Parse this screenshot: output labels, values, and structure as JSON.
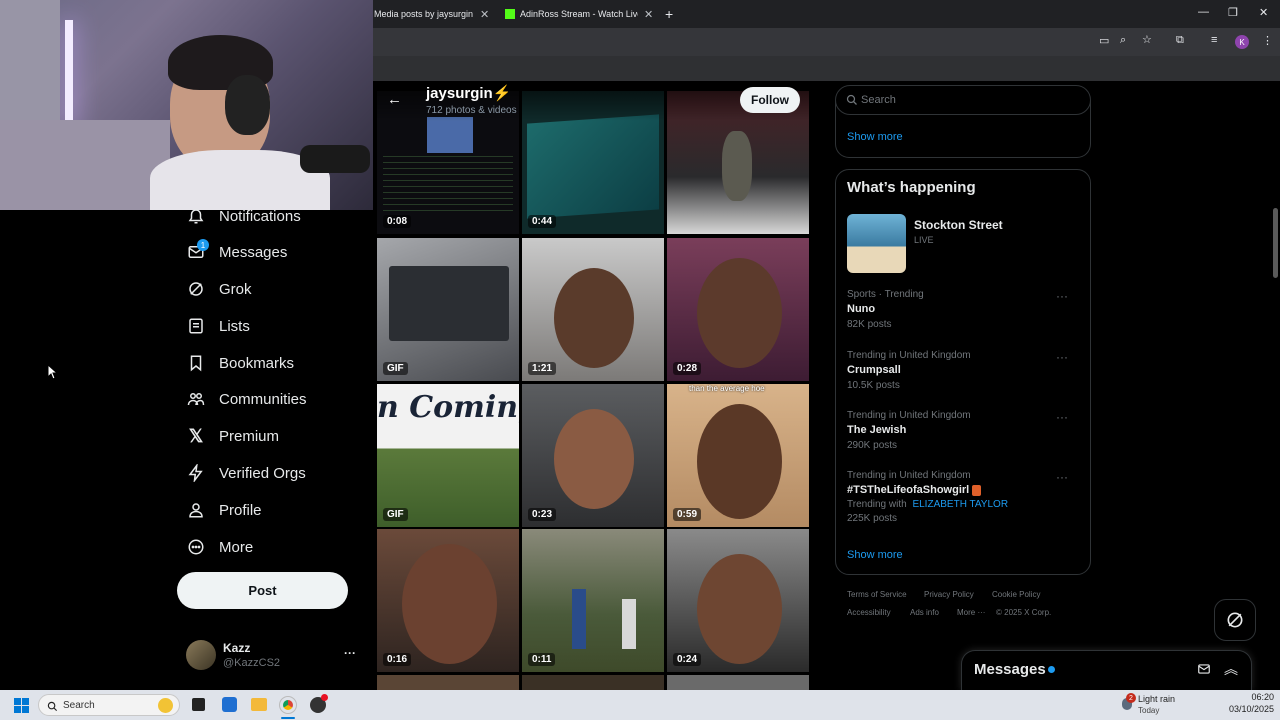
{
  "browser": {
    "tabs": [
      {
        "title": "Media posts by jaysurgin⚡",
        "close": "✕"
      },
      {
        "title": "AdinRoss Stream - Watch Live o",
        "close": "✕"
      }
    ],
    "new_tab": "+",
    "window_controls": {
      "minimize": "—",
      "restore": "❐",
      "close": "✕"
    }
  },
  "sidebar": {
    "items": [
      {
        "label": "Notifications"
      },
      {
        "label": "Messages",
        "badge": "1"
      },
      {
        "label": "Grok"
      },
      {
        "label": "Lists"
      },
      {
        "label": "Bookmarks"
      },
      {
        "label": "Communities"
      },
      {
        "label": "Premium"
      },
      {
        "label": "Verified Orgs"
      },
      {
        "label": "Profile"
      },
      {
        "label": "More"
      }
    ],
    "post_label": "Post",
    "account": {
      "name": "Kazz",
      "handle": "@KazzCS2",
      "more": "···"
    }
  },
  "profile_header": {
    "back": "←",
    "name": "jaysurgin⚡",
    "count": "712 photos & videos",
    "follow_label": "Follow"
  },
  "media": {
    "tiles": [
      {
        "label": "0:08"
      },
      {
        "label": "0:44"
      },
      {
        "label": ""
      },
      {
        "label": "GIF"
      },
      {
        "label": "1:21"
      },
      {
        "label": "0:28"
      },
      {
        "label": "GIF",
        "overlay": "n Coming!"
      },
      {
        "label": "0:23"
      },
      {
        "label": "0:59",
        "caption": "than the average hoe"
      },
      {
        "label": "0:16"
      },
      {
        "label": "0:11"
      },
      {
        "label": "0:24"
      }
    ]
  },
  "right": {
    "search_placeholder": "Search",
    "show_more_top": "Show more",
    "happening_title": "What’s happening",
    "live": {
      "title": "Stockton Street",
      "status": "LIVE"
    },
    "trends": [
      {
        "meta": "Sports · Trending",
        "name": "Nuno",
        "posts": "82K posts"
      },
      {
        "meta": "Trending in United Kingdom",
        "name": "Crumpsall",
        "posts": "10.5K posts"
      },
      {
        "meta": "Trending in United Kingdom",
        "name": "The Jewish",
        "posts": "290K posts"
      },
      {
        "meta": "Trending in United Kingdom",
        "name": "#TSTheLifeofaShowgirl",
        "extra": "Trending with",
        "extra_link": "ELIZABETH TAYLOR",
        "posts": "225K posts"
      }
    ],
    "show_more_bottom": "Show more",
    "footer": [
      "Terms of Service",
      "Privacy Policy",
      "Cookie Policy",
      "Accessibility",
      "Ads info",
      "More ···",
      "© 2025 X Corp."
    ],
    "messages_drawer": "Messages"
  },
  "taskbar": {
    "search_placeholder": "Search",
    "weather": {
      "text": "Light rain",
      "sub": "Today",
      "badge": "2"
    },
    "time": "06:20",
    "date": "03/10/2025"
  },
  "colors": {
    "accent": "#1d9bf0",
    "background": "#000000",
    "border": "#2f3336"
  }
}
